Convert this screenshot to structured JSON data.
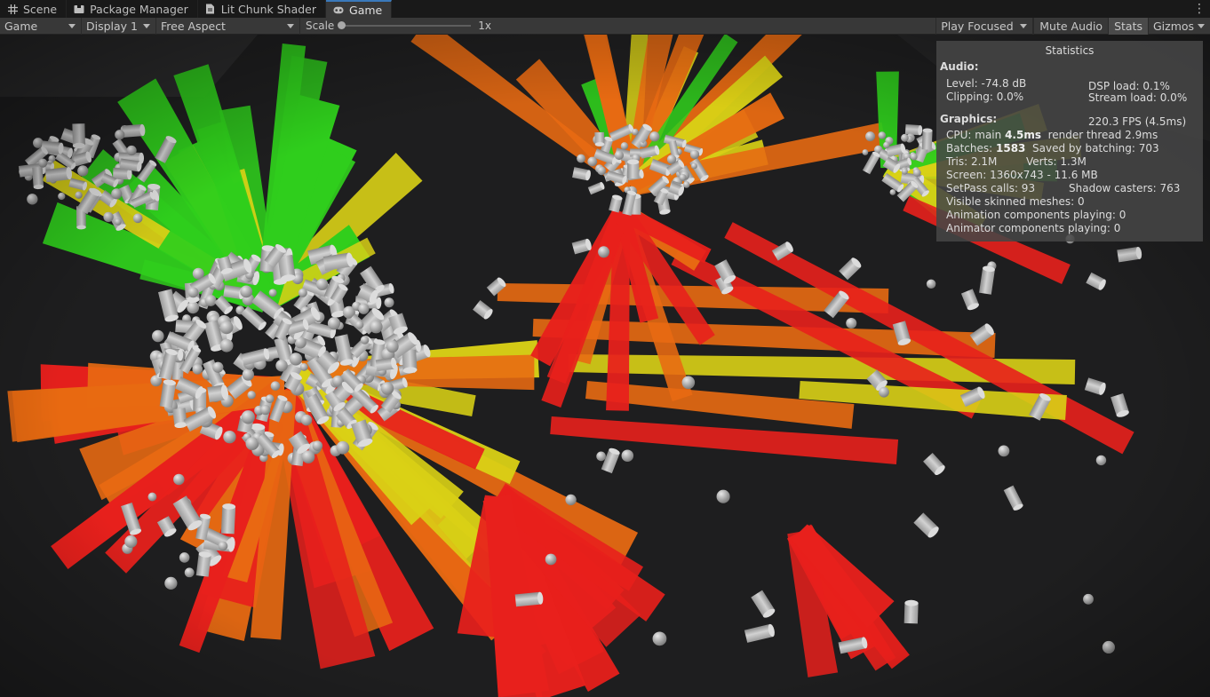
{
  "tabs": [
    {
      "label": "Scene",
      "icon": "grid-icon"
    },
    {
      "label": "Package Manager",
      "icon": "package-icon"
    },
    {
      "label": "Lit Chunk Shader",
      "icon": "shader-icon"
    },
    {
      "label": "Game",
      "icon": "gamepad-icon",
      "active": true
    }
  ],
  "toolbar": {
    "view_select": "Game",
    "display_select": "Display 1",
    "aspect_select": "Free Aspect",
    "scale_label": "Scale",
    "scale_value": "1x",
    "play_mode": "Play Focused",
    "mute_audio": "Mute Audio",
    "stats": "Stats",
    "gizmos": "Gizmos"
  },
  "stats": {
    "title": "Statistics",
    "audio_header": "Audio:",
    "level": "Level: -74.8 dB",
    "clipping": "Clipping: 0.0%",
    "dsp_load": "DSP load: 0.1%",
    "stream_load": "Stream load: 0.0%",
    "graphics_header": "Graphics:",
    "fps": "220.3 FPS (4.5ms)",
    "cpu_prefix": "CPU: main ",
    "cpu_main": "4.5ms",
    "render_thread": "render thread 2.9ms",
    "batches_prefix": "Batches: ",
    "batches": "1583",
    "saved_by_batching": "Saved by batching: 703",
    "tris": "Tris: 2.1M",
    "verts": "Verts: 1.3M",
    "screen": "Screen: 1360x743 - 11.6 MB",
    "setpass": "SetPass calls: 93",
    "shadow_casters": "Shadow casters: 763",
    "skinned_meshes": "Visible skinned meshes: 0",
    "animation_components": "Animation components playing: 0",
    "animator_components": "Animator components playing: 0"
  },
  "colors": {
    "accent": "#3a79bb",
    "heat_red": "#e8201c",
    "heat_orange": "#e86a12",
    "heat_yellow": "#d9d016",
    "heat_green": "#2fce1c",
    "object_grey": "#b4b4b4"
  }
}
